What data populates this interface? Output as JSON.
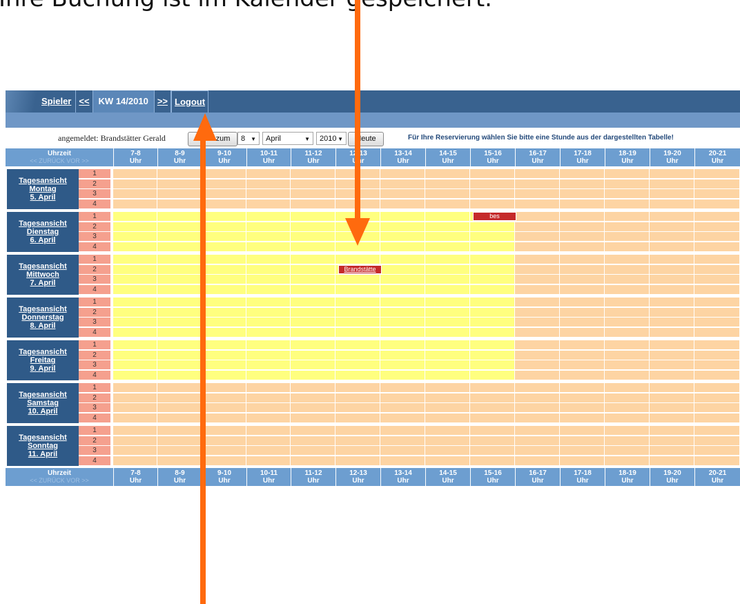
{
  "headline": "Ihre Buchung ist im Kalender gespeichert.",
  "nav": {
    "spieler": "Spieler",
    "prev": "<<",
    "week": "KW  14/2010",
    "next": ">>",
    "logout": "Logout"
  },
  "toolbar": {
    "user": "angemeldet: Brandstätter Gerald",
    "goto_button": "Gehe zum",
    "day_value": "8",
    "month_value": "April",
    "year_value": "2010",
    "today_button": "Heute",
    "info": "Für Ihre Reservierung wählen Sie bitte eine Stunde aus der dargestellten Tabelle!"
  },
  "header": {
    "uhrzeit": "Uhrzeit",
    "zurueck": "<< ZURÜCK",
    "vor": "VOR >>",
    "hours": [
      "7-8",
      "8-9",
      "9-10",
      "10-11",
      "11-12",
      "12-13",
      "13-14",
      "14-15",
      "15-16",
      "16-17",
      "17-18",
      "18-19",
      "19-20",
      "20-21"
    ],
    "uhr": "Uhr"
  },
  "slots": [
    "1",
    "2",
    "3",
    "4"
  ],
  "days": [
    {
      "view": "Tagesansicht",
      "weekday": "Montag",
      "date": "5. April",
      "highlight": false
    },
    {
      "view": "Tagesansicht",
      "weekday": "Dienstag",
      "date": "6. April",
      "highlight": true
    },
    {
      "view": "Tagesansicht",
      "weekday": "Mittwoch",
      "date": "7. April",
      "highlight": true
    },
    {
      "view": "Tagesansicht",
      "weekday": "Donnerstag",
      "date": "8. April",
      "highlight": true
    },
    {
      "view": "Tagesansicht",
      "weekday": "Freitag",
      "date": "9. April",
      "highlight": true
    },
    {
      "view": "Tagesansicht",
      "weekday": "Samstag",
      "date": "10. April",
      "highlight": false
    },
    {
      "view": "Tagesansicht",
      "weekday": "Sonntag",
      "date": "11. April",
      "highlight": false
    }
  ],
  "bookings": [
    {
      "day": 1,
      "hour": "15-16",
      "slot": "1",
      "label": "bes"
    },
    {
      "day": 2,
      "hour": "12-13",
      "slot": "2",
      "label": "Brandstätte"
    }
  ],
  "colors": {
    "nav_bg": "#39628f",
    "header_bg": "#6d9ed0",
    "day_label_bg": "#2f5a88",
    "slot_bg": "#f5a08e",
    "cell_peach": "#fdd4a3",
    "cell_yellow": "#ffff7f",
    "booking": "#c52a2a",
    "annotation_arrow": "#ff6a0e"
  }
}
